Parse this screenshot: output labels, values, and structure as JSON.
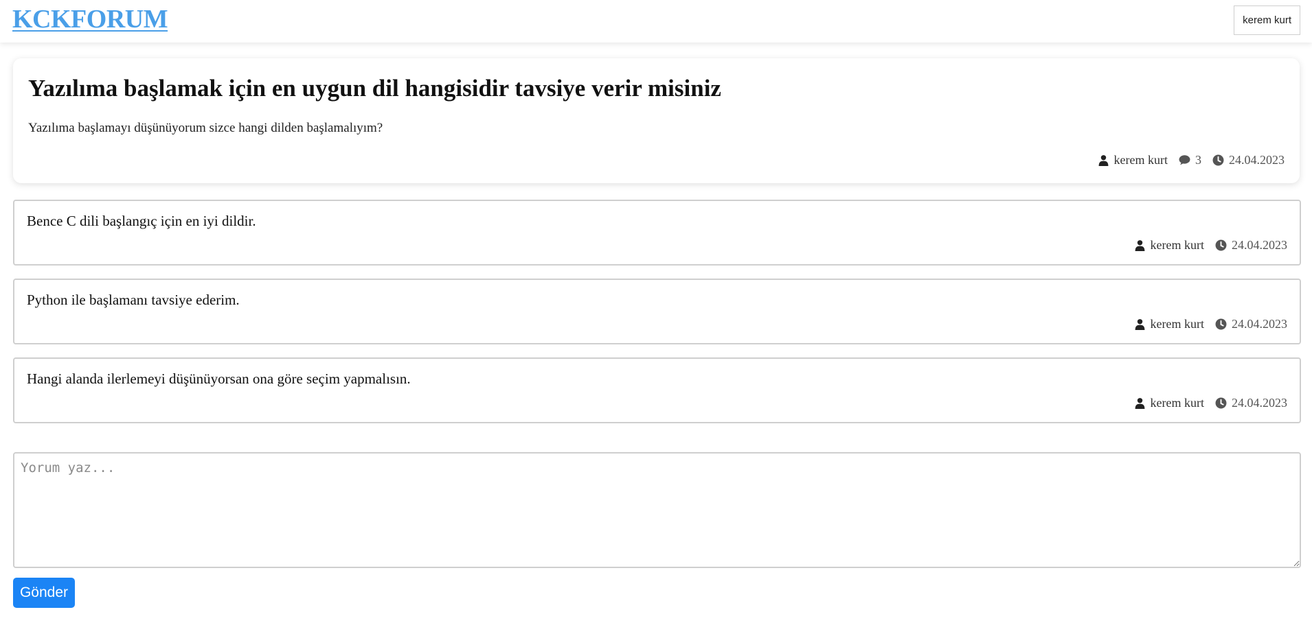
{
  "header": {
    "logo": "KCKFORUM",
    "user_label": "kerem kurt"
  },
  "topic": {
    "title": "Yazılıma başlamak için en uygun dil hangisidir tavsiye verir misiniz",
    "body": "Yazılıma başlamayı düşünüyorum sizce hangi dilden başlamalıyım?",
    "author": "kerem kurt",
    "comment_count": "3",
    "date": "24.04.2023"
  },
  "comments": [
    {
      "text": "Bence C dili başlangıç için en iyi dildir.",
      "author": "kerem kurt",
      "date": "24.04.2023"
    },
    {
      "text": "Python ile başlamanı tavsiye ederim.",
      "author": "kerem kurt",
      "date": "24.04.2023"
    },
    {
      "text": "Hangi alanda ilerlemeyi düşünüyorsan ona göre seçim yapmalısın.",
      "author": "kerem kurt",
      "date": "24.04.2023"
    }
  ],
  "comment_form": {
    "placeholder": "Yorum yaz...",
    "value": "",
    "submit_label": "Gönder"
  },
  "icons": {
    "author": "user-icon",
    "comments": "comment-icon",
    "date": "clock-icon"
  },
  "colors": {
    "logo": "#4a9fe8",
    "primary_button": "#1b84f5",
    "icon": "#222222"
  }
}
